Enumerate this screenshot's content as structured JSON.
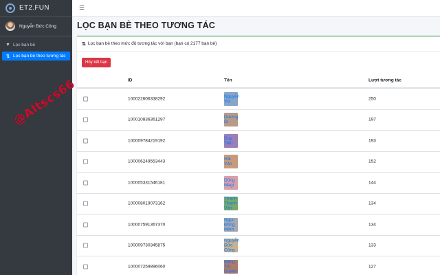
{
  "app": {
    "brand": "ET2.FUN"
  },
  "user": {
    "name": "Nguyễn Đức Công"
  },
  "sidebar": {
    "items": [
      {
        "label": "Lọc bạn bè",
        "icon": "filter-icon",
        "active": false
      },
      {
        "label": "Lọc bạn bè theo tương tác",
        "icon": "sort-icon",
        "active": true
      }
    ]
  },
  "page": {
    "title": "LỌC BẠN BÈ THEO TƯƠNG TÁC",
    "card_header": "Lọc bạn bè theo mức độ tương tác với bạn (bạn có 2177 bạn bè)",
    "unfriend_button": "Hủy kết bạn"
  },
  "table": {
    "headers": {
      "id": "ID",
      "name": "Tên",
      "count": "Lượt tương tác"
    },
    "rows": [
      {
        "id": "100022606338292",
        "name": "Nguyễn Vui",
        "count": "250",
        "thumb": "#8aa4c8"
      },
      {
        "id": "100010836361297",
        "name": "Dương Di",
        "count": "197",
        "thumb": "#b89a86"
      },
      {
        "id": "100009784219192",
        "name": "Duy Tiến",
        "count": "193",
        "thumb": "#9a7fb8"
      },
      {
        "id": "100006249553443",
        "name": "Hải Vân",
        "count": "152",
        "thumb": "#c99a7a"
      },
      {
        "id": "100005331546181",
        "name": "Dũng Magi",
        "count": "144",
        "thumb": "#d8a0a8"
      },
      {
        "id": "100008019073162",
        "name": "Thanh Thanh Vân",
        "count": "134",
        "thumb": "#7aa86a"
      },
      {
        "id": "100007591367370",
        "name": "Ngọc Đồng Minh",
        "count": "134",
        "thumb": "#a8a8b0"
      },
      {
        "id": "100009730345875",
        "name": "Nguyễn Đức Công",
        "count": "133",
        "thumb": "#c8b090"
      },
      {
        "id": "100007259896060",
        "name": "Đặng Thị Duyên",
        "count": "127",
        "thumb": "#b07a6a"
      }
    ]
  },
  "watermark": {
    "text": "@Altscs66"
  },
  "colors": {
    "accent": "#007bff",
    "danger": "#dc3545",
    "sidebar": "#343a40",
    "success": "#28a745"
  }
}
